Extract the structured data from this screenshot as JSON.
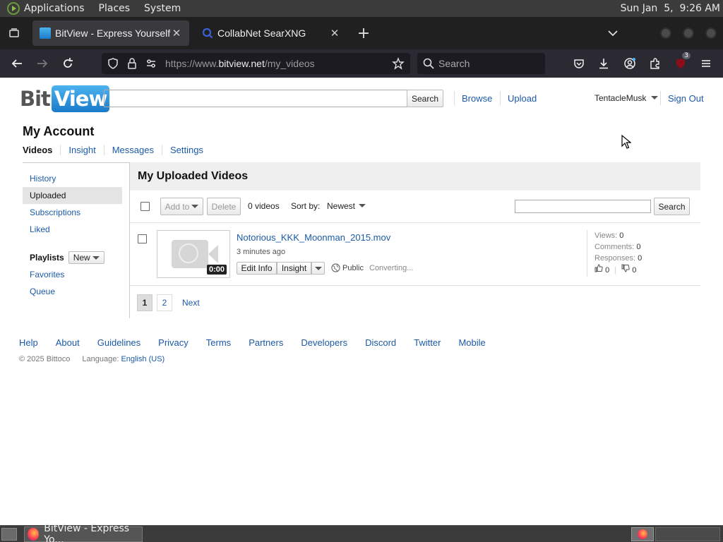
{
  "os_panel": {
    "menus": [
      "Applications",
      "Places",
      "System"
    ],
    "clock": "Sun Jan  5,  9:26 AM"
  },
  "browser": {
    "tabs": [
      {
        "title": "BitView - Express Yourself.",
        "active": true
      },
      {
        "title": "CollabNet SearXNG",
        "active": false
      }
    ],
    "url_prefix": "https://www.",
    "url_domain": "bitview.net",
    "url_path": "/my_videos",
    "search_placeholder": "Search",
    "extension_badge": "3"
  },
  "site": {
    "logo_left": "Bit",
    "logo_right": "View",
    "search_button": "Search",
    "nav": [
      "Browse",
      "Upload"
    ],
    "username": "TentacleMusk",
    "sign_out": "Sign Out"
  },
  "account": {
    "title": "My Account",
    "tabs": [
      "Videos",
      "Insight",
      "Messages",
      "Settings"
    ]
  },
  "sidebar": {
    "items": [
      "History",
      "Uploaded",
      "Subscriptions",
      "Liked"
    ],
    "playlists_label": "Playlists",
    "new_button": "New",
    "playlist_items": [
      "Favorites",
      "Queue"
    ]
  },
  "main": {
    "heading": "My Uploaded Videos",
    "add_to": "Add to",
    "delete": "Delete",
    "video_count": "0 videos",
    "sort_label": "Sort by:",
    "sort_value": "Newest",
    "search_button": "Search",
    "video": {
      "title": "Notorious_KKK_Moonman_2015.mov",
      "time": "3 minutes ago",
      "duration": "0:00",
      "edit_info": "Edit Info",
      "insight": "Insight",
      "privacy": "Public",
      "status": "Converting...",
      "views_label": "Views:",
      "views": "0",
      "comments_label": "Comments:",
      "comments": "0",
      "responses_label": "Responses:",
      "responses": "0",
      "likes": "0",
      "dislikes": "0"
    },
    "pages": [
      "1",
      "2"
    ],
    "next": "Next"
  },
  "footer": {
    "links": [
      "Help",
      "About",
      "Guidelines",
      "Privacy",
      "Terms",
      "Partners",
      "Developers",
      "Discord",
      "Twitter",
      "Mobile"
    ],
    "copyright": "© 2025 Bittoco",
    "language_label": "Language:",
    "language": "English (US)"
  },
  "taskbar": {
    "window_title": "BitView - Express Yo..."
  }
}
